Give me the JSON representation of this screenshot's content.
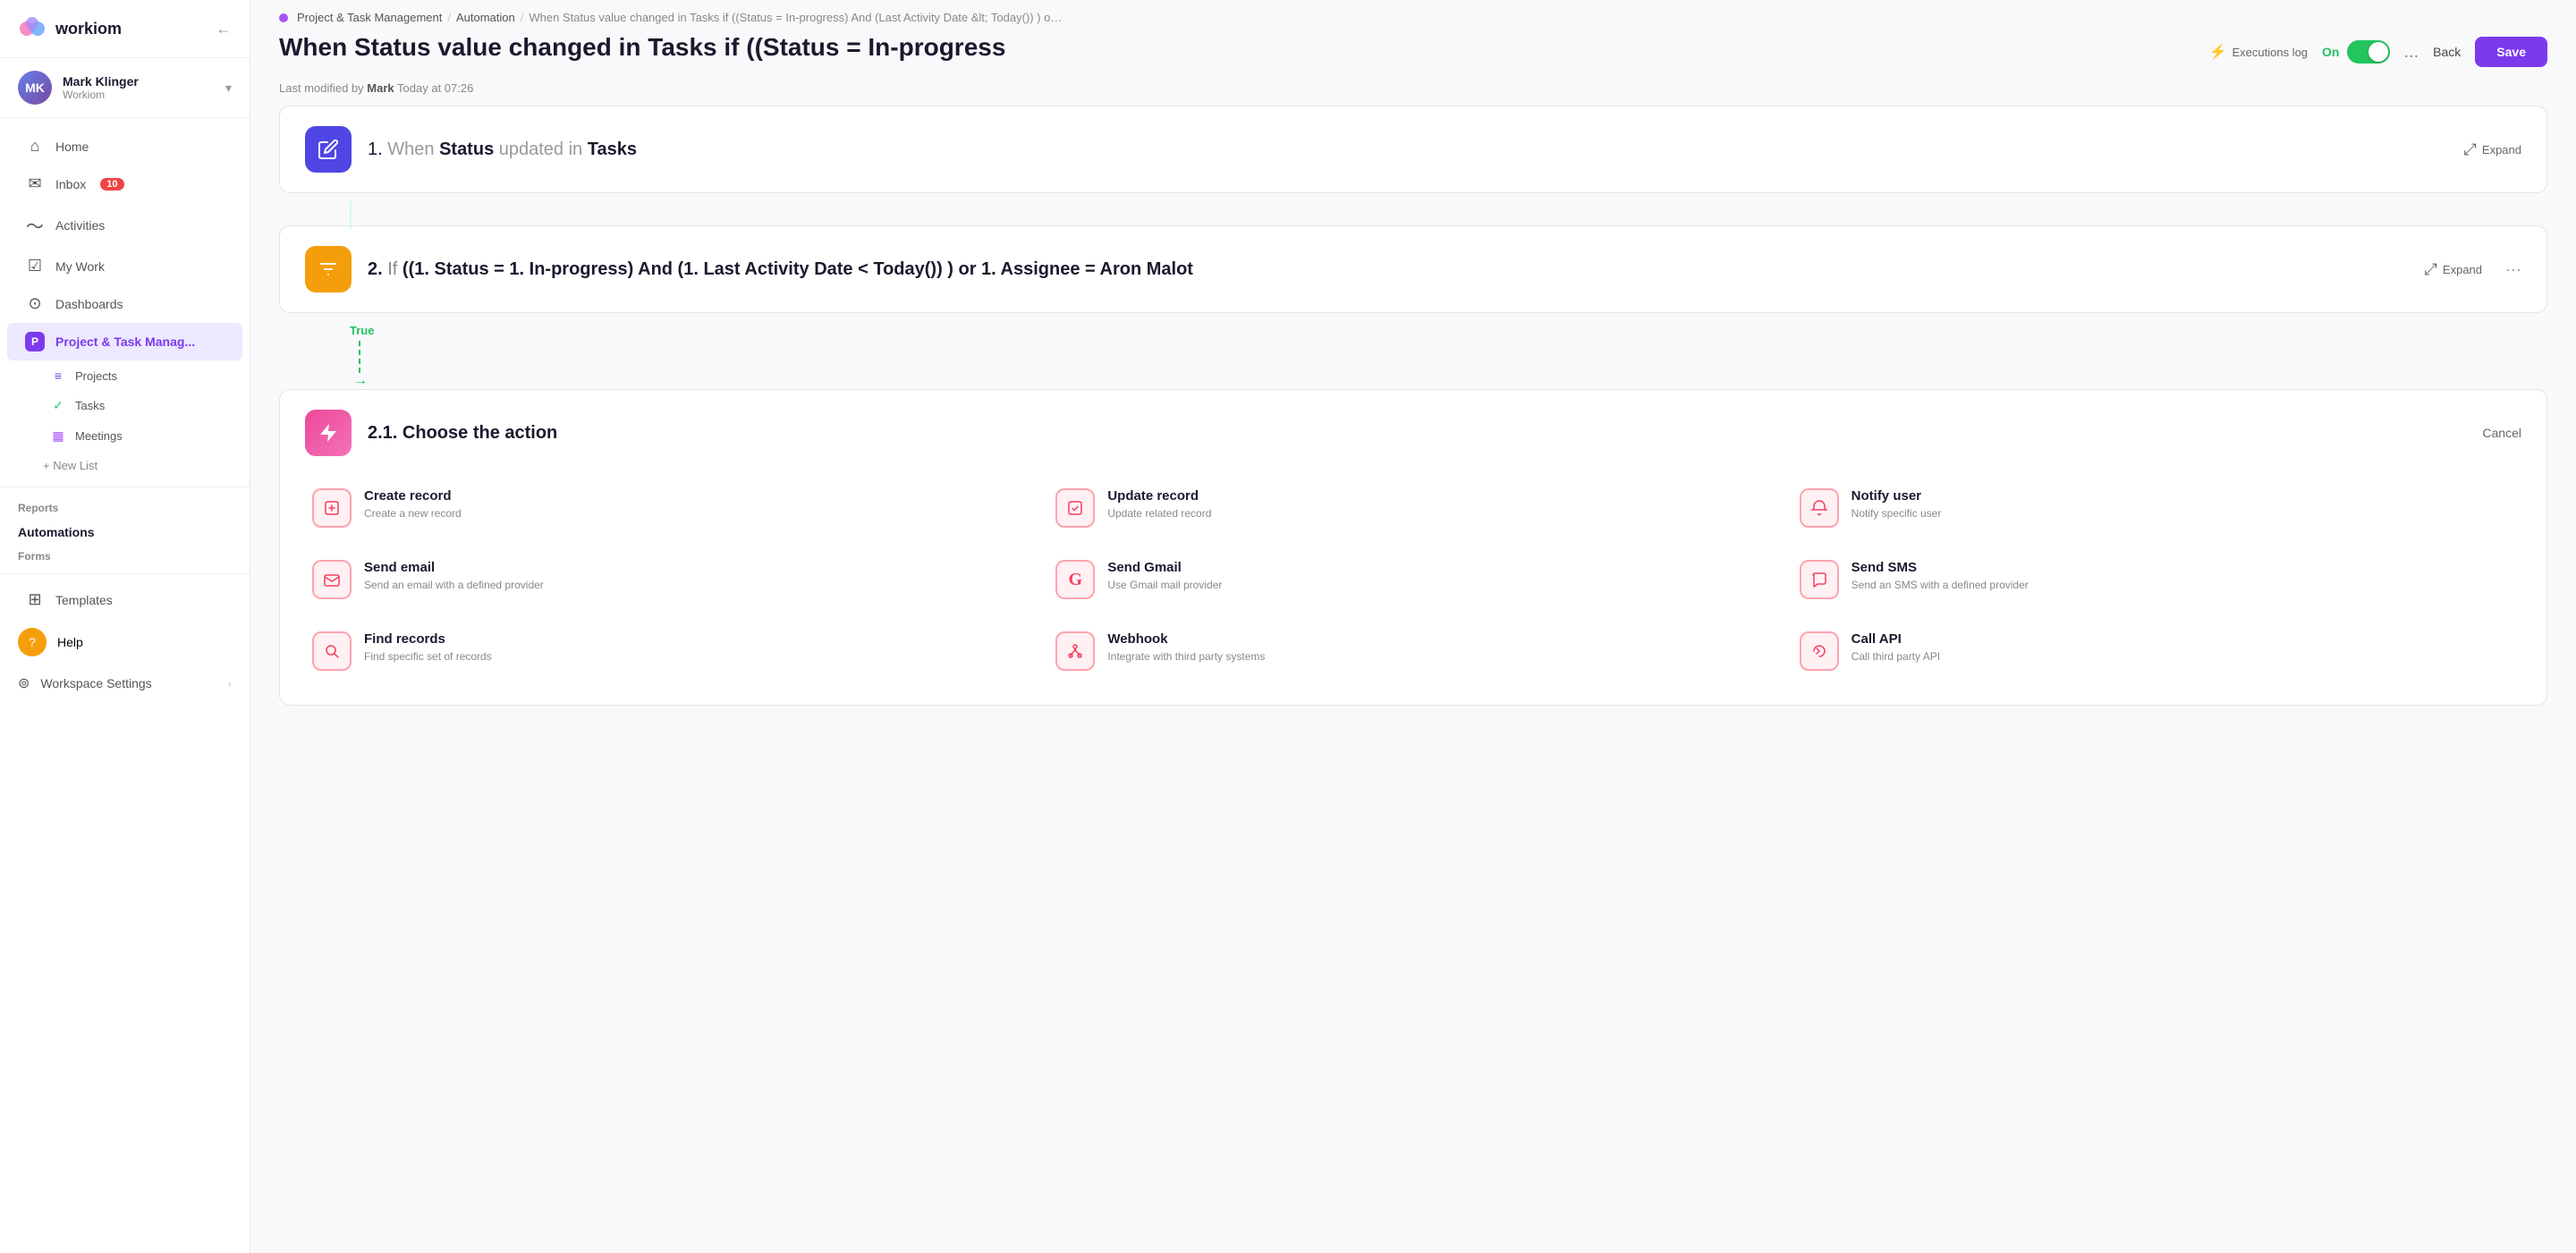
{
  "app": {
    "name": "workiom"
  },
  "sidebar": {
    "collapse_icon": "←",
    "user": {
      "name": "Mark Klinger",
      "org": "Workiom",
      "initials": "MK"
    },
    "nav_items": [
      {
        "id": "home",
        "label": "Home",
        "icon": "⌂",
        "active": false
      },
      {
        "id": "inbox",
        "label": "Inbox",
        "icon": "✉",
        "badge": "10",
        "active": false
      },
      {
        "id": "activities",
        "label": "Activities",
        "icon": "〜",
        "active": false
      },
      {
        "id": "mywork",
        "label": "My Work",
        "icon": "☑",
        "active": false
      },
      {
        "id": "dashboards",
        "label": "Dashboards",
        "icon": "⊙",
        "active": false
      },
      {
        "id": "project",
        "label": "Project & Task Manag...",
        "icon": "",
        "active": true
      }
    ],
    "sub_items": [
      {
        "id": "projects",
        "label": "Projects",
        "icon": "≡",
        "color": "#4f46e5"
      },
      {
        "id": "tasks",
        "label": "Tasks",
        "icon": "✓",
        "color": "#22c55e"
      },
      {
        "id": "meetings",
        "label": "Meetings",
        "icon": "▦",
        "color": "#a855f7"
      }
    ],
    "new_list_label": "+ New List",
    "section_items": [
      {
        "id": "reports",
        "label": "Reports"
      },
      {
        "id": "automations",
        "label": "Automations",
        "active": true
      },
      {
        "id": "forms",
        "label": "Forms"
      }
    ],
    "bottom_items": [
      {
        "id": "templates",
        "label": "Templates",
        "icon": "⊞"
      },
      {
        "id": "help",
        "label": "Help",
        "icon": "?"
      },
      {
        "id": "workspace",
        "label": "Workspace Settings"
      }
    ]
  },
  "breadcrumb": {
    "items": [
      {
        "label": "Project & Task Management",
        "link": true
      },
      {
        "label": "Automation",
        "link": true
      },
      {
        "label": "When Status value changed in Tasks if ((Status = In-progress) And (Last Activity Date &lt; Today()) ) or Assignee = Aron Malot  then update reco...",
        "link": false
      }
    ]
  },
  "page": {
    "title": "When Status value changed in Tasks if ((Status = In-progress",
    "modified_prefix": "Last modified by",
    "modified_by": "Mark",
    "modified_time": "Today at 07:26",
    "actions": {
      "exec_log": "Executions log",
      "toggle_label": "On",
      "more": "...",
      "back": "Back",
      "save": "Save"
    }
  },
  "steps": [
    {
      "id": "step1",
      "number": "1.",
      "keyword_when": "When",
      "field": "Status",
      "keyword_updated": "updated in",
      "table": "Tasks",
      "icon": "✎",
      "icon_class": "step-icon-blue",
      "expand_label": "Expand"
    },
    {
      "id": "step2",
      "number": "2.",
      "keyword_if": "If",
      "condition": "((1. Status = 1. In-progress) And (1. Last Activity Date < Today()) ) or 1. Assignee = Aron Malot",
      "icon": "≡",
      "icon_class": "step-icon-orange",
      "expand_label": "Expand"
    }
  ],
  "true_label": "True",
  "action_chooser": {
    "number": "2.1.",
    "title": "Choose the action",
    "cancel": "Cancel",
    "icon": "⚡",
    "options": [
      {
        "id": "create-record",
        "title": "Create record",
        "desc": "Create a new record",
        "icon": "📄"
      },
      {
        "id": "update-record",
        "title": "Update record",
        "desc": "Update related record",
        "icon": "✏"
      },
      {
        "id": "notify-user",
        "title": "Notify user",
        "desc": "Notify specific user",
        "icon": "🔔"
      },
      {
        "id": "send-email",
        "title": "Send email",
        "desc": "Send an email with a defined provider",
        "icon": "✉"
      },
      {
        "id": "send-gmail",
        "title": "Send Gmail",
        "desc": "Use Gmail mail provider",
        "icon": "G"
      },
      {
        "id": "send-sms",
        "title": "Send SMS",
        "desc": "Send an SMS with a defined provider",
        "icon": "💬"
      },
      {
        "id": "find-records",
        "title": "Find records",
        "desc": "Find specific set of records",
        "icon": "🔍"
      },
      {
        "id": "webhook",
        "title": "Webhook",
        "desc": "Integrate with third party systems",
        "icon": "⚙"
      },
      {
        "id": "call-api",
        "title": "Call API",
        "desc": "Call third party API",
        "icon": "🔀"
      }
    ]
  }
}
